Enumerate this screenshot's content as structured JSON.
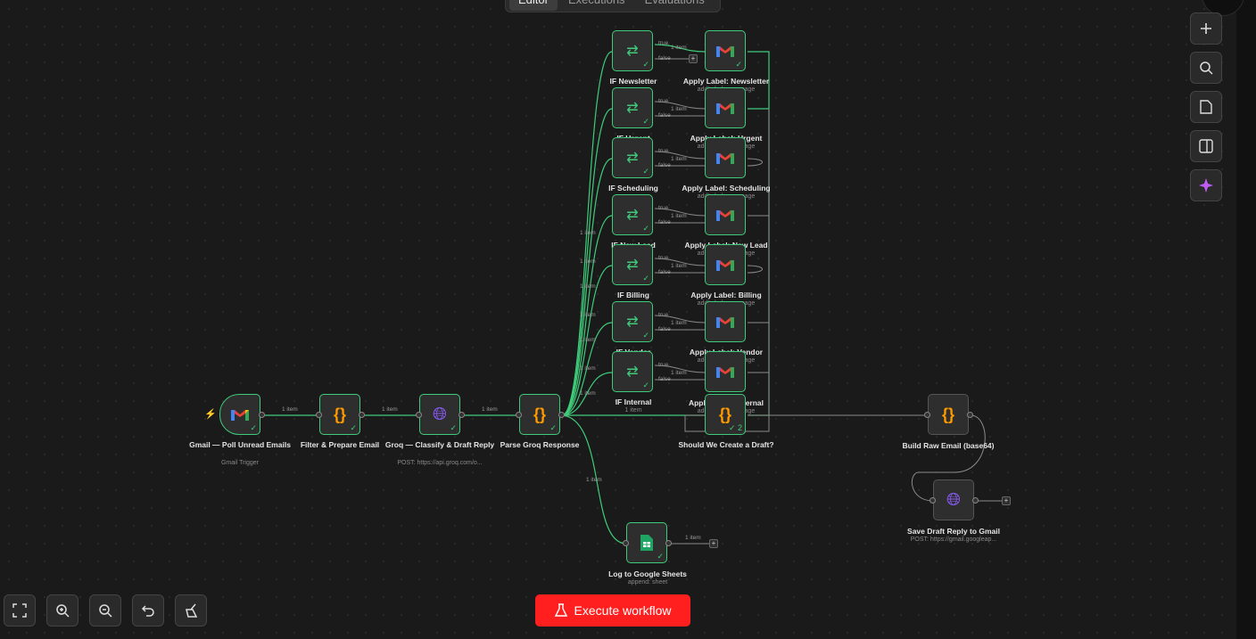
{
  "tabs": [
    "Editor",
    "Executions",
    "Evaluations"
  ],
  "execute_label": "Execute workflow",
  "wire_label": "1 item",
  "true_label": "true",
  "false_label": "false",
  "nodes": {
    "gmail_trigger": {
      "title": "Gmail — Poll Unread Emails",
      "sub": "Gmail Trigger"
    },
    "filter": {
      "title": "Filter & Prepare Email"
    },
    "groq": {
      "title": "Groq — Classify & Draft Reply",
      "sub": "POST: https://api.groq.com/o..."
    },
    "parse": {
      "title": "Parse Groq Response"
    },
    "if_newsletter": {
      "title": "IF Newsletter"
    },
    "if_urgent": {
      "title": "IF Urgent"
    },
    "if_scheduling": {
      "title": "IF Scheduling"
    },
    "if_newlead": {
      "title": "IF New Lead"
    },
    "if_billing": {
      "title": "IF Billing"
    },
    "if_vendor": {
      "title": "IF Vendor"
    },
    "if_internal": {
      "title": "IF Internal",
      "sub": "1 item"
    },
    "lbl_newsletter": {
      "title": "Apply Label: Newsletter",
      "sub": "addLabels: message"
    },
    "lbl_urgent": {
      "title": "Apply Label: Urgent",
      "sub": "addLabels: message"
    },
    "lbl_scheduling": {
      "title": "Apply Label: Scheduling",
      "sub": "addLabels: message"
    },
    "lbl_newlead": {
      "title": "Apply Label: New Lead",
      "sub": "addLabels: message"
    },
    "lbl_billing": {
      "title": "Apply Label: Billing",
      "sub": "addLabels: message"
    },
    "lbl_vendor": {
      "title": "Apply Label: Vendor",
      "sub": "addLabels: message"
    },
    "lbl_internal": {
      "title": "Apply Label: Internal",
      "sub": "addLabels: message"
    },
    "should_draft": {
      "title": "Should We Create a Draft?",
      "count": "2"
    },
    "sheets": {
      "title": "Log to Google Sheets",
      "sub": "append: sheet"
    },
    "build_raw": {
      "title": "Build Raw Email (base64)"
    },
    "save_draft": {
      "title": "Save Draft Reply to Gmail",
      "sub": "POST: https://gmail.googleap..."
    }
  },
  "icons": {
    "right_toolbar": [
      "plus-icon",
      "search-icon",
      "sticky-note-icon",
      "panel-icon",
      "sparkle-icon"
    ],
    "bottom_toolbar": [
      "fullscreen-icon",
      "zoom-in-icon",
      "zoom-out-icon",
      "undo-icon",
      "broom-icon"
    ]
  },
  "colors": {
    "success": "#3fcc7a",
    "execute": "#ff1f1f",
    "code": "#ff9b00",
    "http": "#8b5cf6",
    "sheets": "#1fa463"
  }
}
